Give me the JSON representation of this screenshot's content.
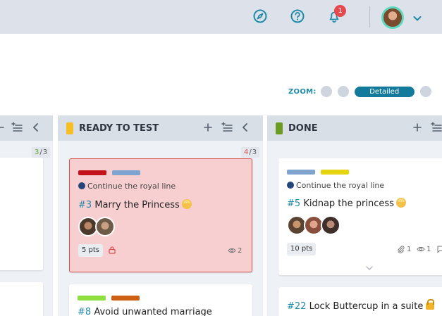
{
  "topbar": {
    "icons": [
      "compass-icon",
      "help-icon",
      "bell-icon"
    ],
    "notification_count": "1",
    "accent": "#1f8ba8"
  },
  "zoom": {
    "label": "ZOOM:",
    "selected": "Detailed",
    "options_count": 4
  },
  "columns": [
    {
      "name": "",
      "wip": {
        "current": "3",
        "sep": "/",
        "limit": "3"
      }
    },
    {
      "name": "READY TO TEST",
      "flag_color": "#f6bf26",
      "wip": {
        "current": "4",
        "sep": "/",
        "limit": "3"
      },
      "cards": [
        {
          "blocked": true,
          "tag_colors": [
            "#c4121b",
            "#7fa4cf"
          ],
          "epic": "Continue the royal line",
          "ref": "#3",
          "title": "Marry the Princess",
          "points": "5 pts",
          "watchers": "2"
        },
        {
          "tag_colors": [
            "#8ee040",
            "#cc5f12"
          ],
          "ref": "#8",
          "title": "Avoid unwanted marriage"
        }
      ]
    },
    {
      "name": "DONE",
      "flag_color": "#6b9c1f",
      "cards": [
        {
          "tag_colors": [
            "#7fa4cf",
            "#e6d410"
          ],
          "epic": "Continue the royal line",
          "ref": "#5",
          "title": "Kidnap the princess",
          "points": "10 pts",
          "attachments": "1",
          "watchers": "1"
        },
        {
          "ref": "#22",
          "title": "Lock Buttercup in a suite"
        }
      ]
    }
  ]
}
